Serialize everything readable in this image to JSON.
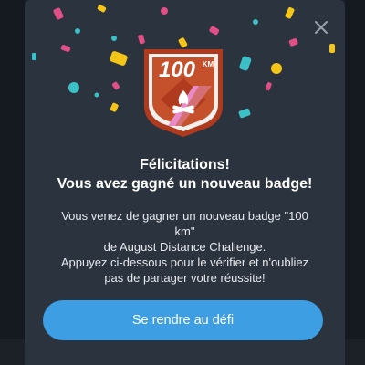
{
  "badge": {
    "value_text": "100",
    "unit_text": "KM",
    "icon": "campfire-icon",
    "colors": {
      "outer": "#b03a1d",
      "inner": "#f2f0ec",
      "diamond": "#c5502c",
      "ribbon": "#e98bc8",
      "ribbon_dark": "#c35a2d",
      "text": "#ffffff"
    }
  },
  "close_icon": "close-icon",
  "headline": {
    "line1": "Félicitations!",
    "line2": "Vous avez gagné un nouveau badge!"
  },
  "message": {
    "line1": "Vous venez de gagner un nouveau badge \"100",
    "line2": "km\"",
    "line3": "de August Distance Challenge.",
    "line4": "Appuyez ci-dessous pour le vérifier et n'oubliez",
    "line5": "pas de partager votre réussite!"
  },
  "cta": {
    "label": "Se rendre au défi"
  },
  "colors": {
    "modal_bg": "#2b333e",
    "button_bg": "#3d9ee3",
    "confetti": [
      "#e24e86",
      "#f5c518",
      "#3bc0c8",
      "#ffffff"
    ]
  }
}
